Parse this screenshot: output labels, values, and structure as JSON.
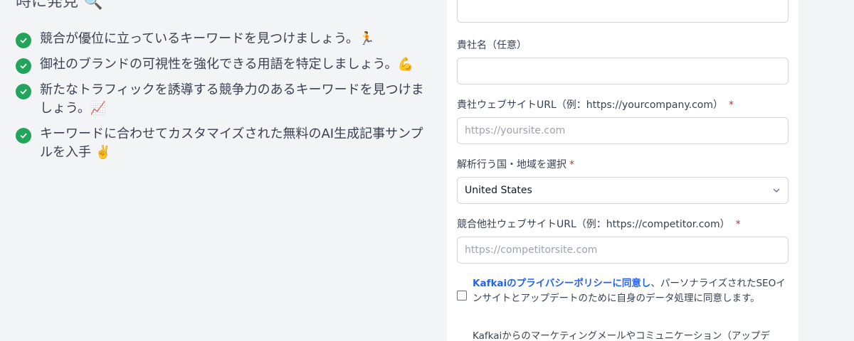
{
  "left": {
    "heading_partial": "時に発見 🔍",
    "benefits": [
      {
        "text": "競合が優位に立っているキーワードを見つけましょう。🏃"
      },
      {
        "text": "御社のブランドの可視性を強化できる用語を特定しましょう。💪"
      },
      {
        "text": "新たなトラフィックを誘導する競争力のあるキーワードを見つけましょう。📈"
      },
      {
        "text": "キーワードに合わせてカスタマイズされた無料のAI生成記事サンプルを入手 ✌️"
      }
    ]
  },
  "form": {
    "top_input": {
      "value": ""
    },
    "company_name": {
      "label": "貴社名（任意）",
      "value": ""
    },
    "company_url": {
      "label": "貴社ウェブサイトURL（例：https://yourcompany.com）",
      "required_mark": "*",
      "placeholder": "https://yoursite.com"
    },
    "country": {
      "label": "解析行う国・地域を選択",
      "required_mark": "*",
      "selected": "United States"
    },
    "competitor_url": {
      "label": "競合他社ウェブサイトURL（例：https://competitor.com）",
      "required_mark": "*",
      "placeholder": "https://competitorsite.com"
    },
    "privacy_consent": {
      "link_text": "Kafkaiのプライバシーポリシーに同意し",
      "rest_text": "、パーソナライズされたSEOインサイトとアップデートのために自身のデータ処理に同意します。"
    },
    "marketing_consent": {
      "text": "Kafkaiからのマーケティングメールやコミュニケーション（アップデ"
    }
  },
  "colors": {
    "check_green": "#22a55b",
    "link_blue": "#2563eb",
    "required_red": "#dc2626"
  }
}
